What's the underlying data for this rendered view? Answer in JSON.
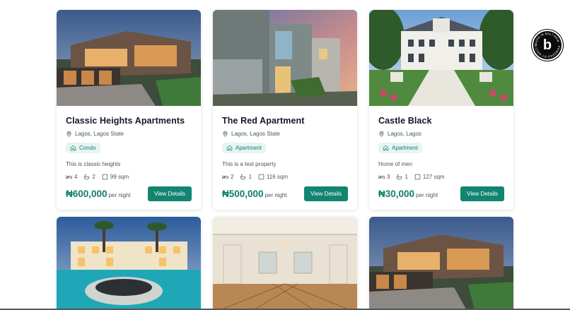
{
  "listings": [
    {
      "title": "Classic Heights Apartments",
      "location": "Lagos, Lagos State",
      "type": "Condo",
      "description": "This is classic heights",
      "beds": "4",
      "baths": "2",
      "area": "99 sqm",
      "price": "₦600,000",
      "per": "per night",
      "button": "View Details"
    },
    {
      "title": "The Red Apartment",
      "location": "Lagos, Lagos State",
      "type": "Apartment",
      "description": "This is a test property",
      "beds": "2",
      "baths": "1",
      "area": "116 sqm",
      "price": "₦500,000",
      "per": "per night",
      "button": "View Details"
    },
    {
      "title": "Castle Black",
      "location": "Lagos, Lagos",
      "type": "Apartment",
      "description": "Home of men",
      "beds": "3",
      "baths": "1",
      "area": "127 sqm",
      "price": "₦30,000",
      "per": "per night",
      "button": "View Details"
    }
  ],
  "bolt_badge": {
    "letter": "b",
    "ring_text": "MADE IN BOLT.NEW · POWERED BY BOLT.NEW ·"
  },
  "colors": {
    "accent": "#128571",
    "accent_text": "#0f7f6d",
    "badge_bg": "#e6f5f2"
  }
}
